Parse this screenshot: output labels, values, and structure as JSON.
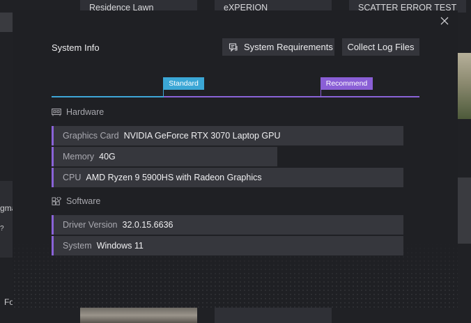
{
  "background": {
    "cards": [
      "Residence Lawn",
      "eXPERION",
      "SCATTER ERROR TEST"
    ],
    "left_partial_text": "gma",
    "left_help_glyph": "?",
    "left_bottom_text": "Fo"
  },
  "modal": {
    "title": "System Info",
    "buttons": {
      "requirements_label": "System Requirements",
      "logs_label": "Collect Log Files"
    },
    "levels": {
      "standard": "Standard",
      "recommend": "Recommend"
    },
    "hardware": {
      "heading": "Hardware",
      "rows": [
        {
          "label": "Graphics Card",
          "value": "NVIDIA GeForce RTX 3070 Laptop GPU"
        },
        {
          "label": "Memory",
          "value": "40G"
        },
        {
          "label": "CPU",
          "value": "AMD Ryzen 9 5900HS with Radeon Graphics"
        }
      ]
    },
    "software": {
      "heading": "Software",
      "rows": [
        {
          "label": "Driver Version",
          "value": "32.0.15.6636"
        },
        {
          "label": "System",
          "value": "Windows 11"
        }
      ]
    }
  },
  "colors": {
    "standard_accent": "#3ba7d6",
    "recommend_accent": "#8a5fd6",
    "row_bg": "#36373d"
  },
  "icons": {
    "close": "close-icon",
    "requirements": "chat-list-icon",
    "hardware": "hardware-icon",
    "software": "software-icon"
  }
}
